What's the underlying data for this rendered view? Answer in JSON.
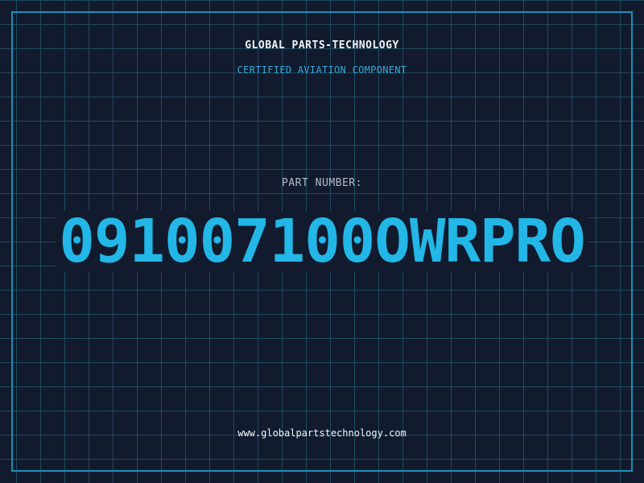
{
  "header": {
    "company": "GLOBAL PARTS-TECHNOLOGY",
    "subtitle": "CERTIFIED AVIATION COMPONENT"
  },
  "part": {
    "label": "PART NUMBER:",
    "number": "091007100OWRPRO"
  },
  "footer": {
    "website": "www.globalpartstechnology.com"
  },
  "colors": {
    "background": "#121b2e",
    "grid": "#1f4a5f",
    "frame": "#1c8fb8",
    "accent": "#22b7e6",
    "subtitle": "#35a9d6",
    "label": "#b4bac4",
    "text": "#f2f4f7"
  }
}
